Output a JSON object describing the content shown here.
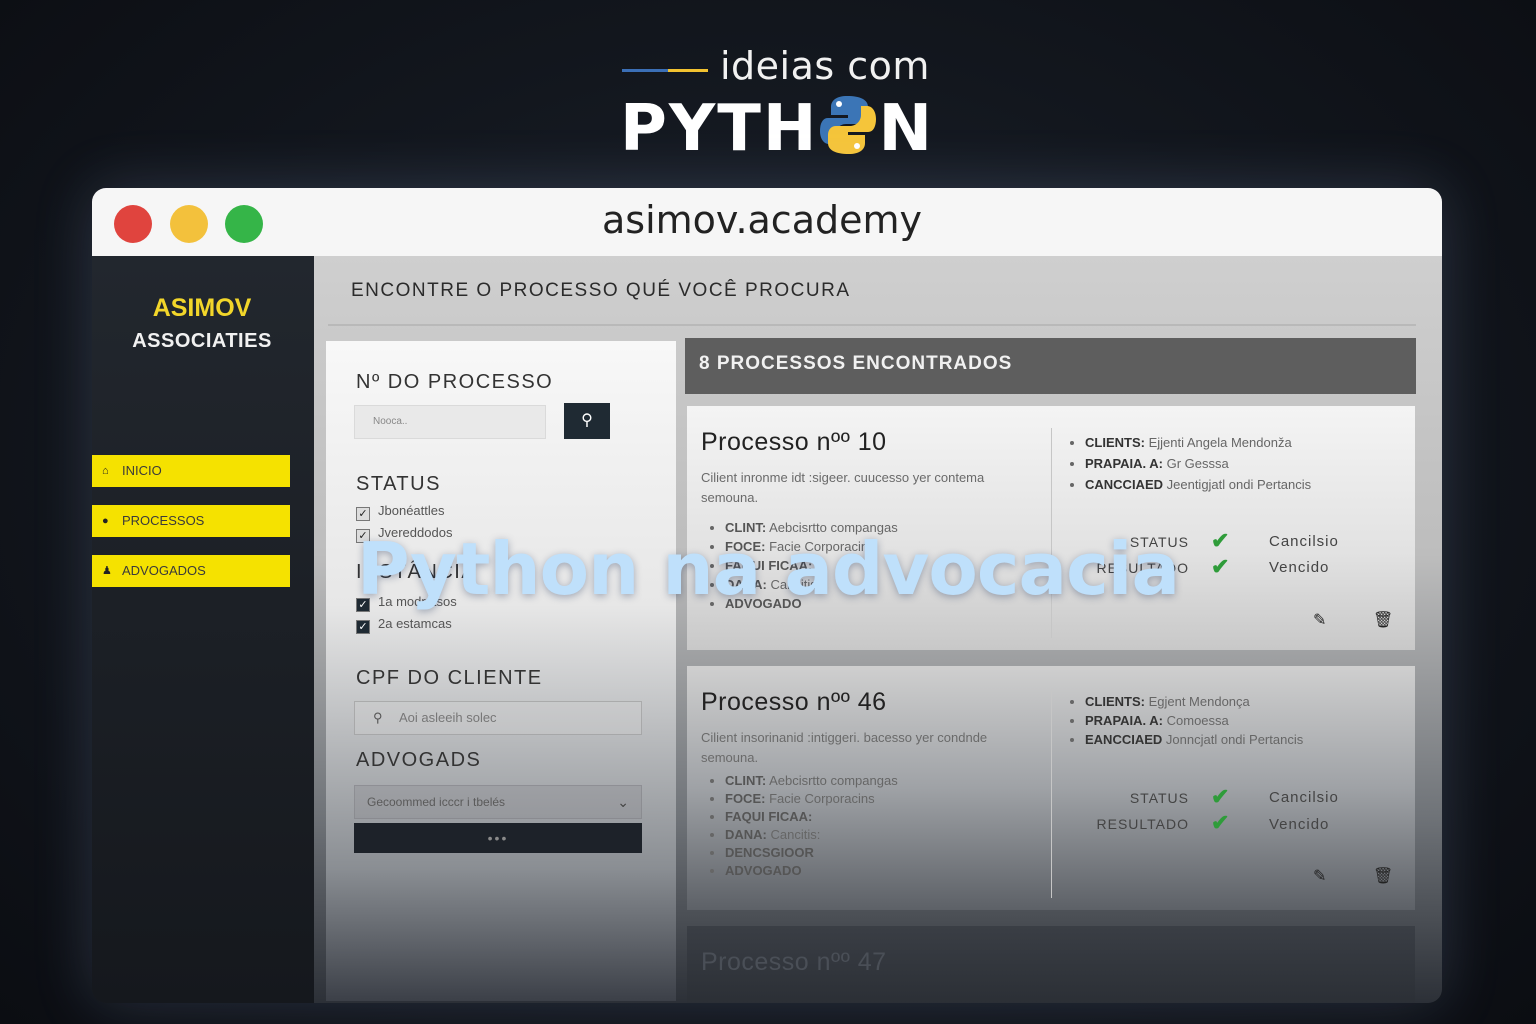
{
  "brand": {
    "top": "ideias com",
    "main_left": "PYTH",
    "main_right": "N",
    "icon": "python-logo"
  },
  "browser": {
    "url": "asimov.academy"
  },
  "sidebar": {
    "logo_line1": "ASIMOV",
    "logo_line2": "ASSOCIATIES",
    "items": [
      {
        "label": "INICIO",
        "icon": "home-icon"
      },
      {
        "label": "PROCESSOS",
        "icon": "circle-icon"
      },
      {
        "label": "ADVOGADOS",
        "icon": "users-icon"
      }
    ]
  },
  "main": {
    "heading": "ENCONTRE O PROCESSO QUÉ VOCÊ PROCURA"
  },
  "filters": {
    "process_label": "Nº DO PROCESSO",
    "process_placeholder": "Nooca..",
    "status_label": "STATUS",
    "status_options": [
      {
        "label": "Jbonéattles",
        "checked": true
      },
      {
        "label": "Jvereddodos",
        "checked": true
      }
    ],
    "instancia_label": "INSTÂNCIA",
    "instancia_options": [
      {
        "label": "1a modratsos",
        "checked": true
      },
      {
        "label": "2a estamcas",
        "checked": true
      }
    ],
    "cpf_label": "CPF DO CLIENTE",
    "cpf_placeholder": "Aoi asleeih solec",
    "advogados_label": "ADVOGADS",
    "advogados_select": "Gecoommed icccr i tbelés",
    "button_label": "•••"
  },
  "results": {
    "count_label": "8 PROCESSOS ENCONTRADOS",
    "cards": [
      {
        "title": "Processo nºº 10",
        "description": "Cilient inronme idt :sigeer. cuucesso yer contema semouna.",
        "details": [
          {
            "key": "CLINT:",
            "value": "Aebcisrtto compangas"
          },
          {
            "key": "FOCE:",
            "value": "Facie Corporacins"
          },
          {
            "key": "FAQUI FICAA:",
            "value": ""
          },
          {
            "key": "DANA:",
            "value": "Cancitis"
          },
          {
            "key": "ADVOGADO",
            "value": ""
          }
        ],
        "info": [
          {
            "key": "CLIENTS:",
            "value": "Ejjenti Angela Mendonža"
          },
          {
            "key": "PRAPAIA. A:",
            "value": "Gr Gesssa"
          },
          {
            "key": "CANCCIAED",
            "value": "Jeentigjatl ondi Pertancis"
          }
        ],
        "status_label": "STATUS",
        "status_value": "Cancilsio",
        "result_label": "RESULTADO",
        "result_value": "Vencido"
      },
      {
        "title": "Processo nºº 46",
        "description": "Cilient insorinanid :intiggeri. bacesso yer condnde semouna.",
        "details": [
          {
            "key": "CLINT:",
            "value": "Aebcisrtto compangas"
          },
          {
            "key": "FOCE:",
            "value": "Facie Corporacins"
          },
          {
            "key": "FAQUI FICAA:",
            "value": ""
          },
          {
            "key": "DANA:",
            "value": "Cancitis:"
          },
          {
            "key": "DENCSGIOOR",
            "value": ""
          },
          {
            "key": "ADVOGADO",
            "value": ""
          }
        ],
        "info": [
          {
            "key": "CLIENTS:",
            "value": "Egjent Mendonça"
          },
          {
            "key": "PRAPAIA. A:",
            "value": "Comoessa"
          },
          {
            "key": "EANCCIAED",
            "value": "Jonncjatl ondi Pertancis"
          }
        ],
        "status_label": "STATUS",
        "status_value": "Cancilsio",
        "result_label": "RESULTADO",
        "result_value": "Vencido"
      },
      {
        "title": "Processo nºº 47"
      }
    ]
  },
  "overlay_title": "Python na advocacia",
  "colors": {
    "accent_yellow": "#f5e200",
    "dark": "#1f2a33",
    "overlay": "#bfe0fb",
    "check": "#2f9c3a"
  }
}
